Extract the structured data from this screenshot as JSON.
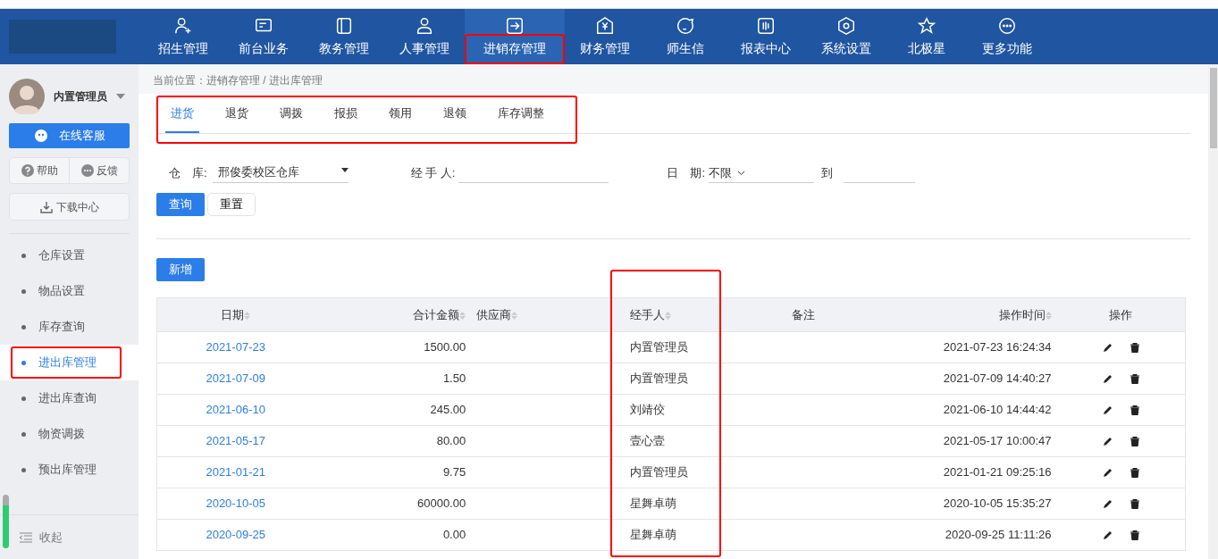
{
  "nav": {
    "items": [
      {
        "label": "招生管理",
        "selected": false,
        "highlighted": false
      },
      {
        "label": "前台业务",
        "selected": false,
        "highlighted": false
      },
      {
        "label": "教务管理",
        "selected": false,
        "highlighted": false
      },
      {
        "label": "人事管理",
        "selected": false,
        "highlighted": false
      },
      {
        "label": "进销存管理",
        "selected": true,
        "highlighted": true
      },
      {
        "label": "财务管理",
        "selected": false,
        "highlighted": false
      },
      {
        "label": "师生信",
        "selected": false,
        "highlighted": false
      },
      {
        "label": "报表中心",
        "selected": false,
        "highlighted": false
      },
      {
        "label": "系统设置",
        "selected": false,
        "highlighted": false
      },
      {
        "label": "北极星",
        "selected": false,
        "highlighted": false
      },
      {
        "label": "更多功能",
        "selected": false,
        "highlighted": false
      }
    ]
  },
  "sidebar": {
    "user": "内置管理员",
    "service_button": "在线客服",
    "help_button": "帮助",
    "feedback_button": "反馈",
    "download_button": "下载中心",
    "items": [
      {
        "label": "仓库设置",
        "selected": false,
        "highlighted": false
      },
      {
        "label": "物品设置",
        "selected": false,
        "highlighted": false
      },
      {
        "label": "库存查询",
        "selected": false,
        "highlighted": false
      },
      {
        "label": "进出库管理",
        "selected": true,
        "highlighted": true
      },
      {
        "label": "进出库查询",
        "selected": false,
        "highlighted": false
      },
      {
        "label": "物资调拨",
        "selected": false,
        "highlighted": false
      },
      {
        "label": "预出库管理",
        "selected": false,
        "highlighted": false
      }
    ],
    "collapse": "收起"
  },
  "breadcrumb": "当前位置：进销存管理 / 进出库管理",
  "tabs": {
    "highlighted": true,
    "items": [
      {
        "label": "进货",
        "selected": true
      },
      {
        "label": "退货",
        "selected": false
      },
      {
        "label": "调拨",
        "selected": false
      },
      {
        "label": "报损",
        "selected": false
      },
      {
        "label": "领用",
        "selected": false
      },
      {
        "label": "退领",
        "selected": false
      },
      {
        "label": "库存调整",
        "selected": false
      }
    ]
  },
  "filters": {
    "warehouse_label": "仓　库:",
    "warehouse_value": "邢俊委校区仓库",
    "handler_label": "经 手 人:",
    "date_label": "日　期:",
    "date_range": "不限",
    "to_label": "到"
  },
  "buttons": {
    "query": "查询",
    "reset": "重置",
    "add": "新增"
  },
  "table": {
    "columns": [
      {
        "label": "日期",
        "sortable": true,
        "highlighted": false
      },
      {
        "label": "合计金额",
        "sortable": true,
        "highlighted": false
      },
      {
        "label": "供应商",
        "sortable": true,
        "highlighted": false
      },
      {
        "label": "经手人",
        "sortable": true,
        "highlighted": true
      },
      {
        "label": "备注",
        "sortable": false,
        "highlighted": false
      },
      {
        "label": "操作时间",
        "sortable": true,
        "highlighted": false
      },
      {
        "label": "操作",
        "sortable": false,
        "highlighted": false
      }
    ],
    "rows": [
      [
        "2021-07-23",
        "1500.00",
        "",
        "内置管理员",
        "",
        "2021-07-23 16:24:34"
      ],
      [
        "2021-07-09",
        "1.50",
        "",
        "内置管理员",
        "",
        "2021-07-09 14:40:27"
      ],
      [
        "2021-06-10",
        "245.00",
        "",
        "刘靖佼",
        "",
        "2021-06-10 14:44:42"
      ],
      [
        "2021-05-17",
        "80.00",
        "",
        "壹心壹",
        "",
        "2021-05-17 10:00:47"
      ],
      [
        "2021-01-21",
        "9.75",
        "",
        "内置管理员",
        "",
        "2021-01-21 09:25:16"
      ],
      [
        "2020-10-05",
        "60000.00",
        "",
        "星舞卓萌",
        "",
        "2020-10-05 15:35:27"
      ],
      [
        "2020-09-25",
        "0.00",
        "",
        "星舞卓萌",
        "",
        "2020-09-25 11:11:26"
      ]
    ]
  }
}
